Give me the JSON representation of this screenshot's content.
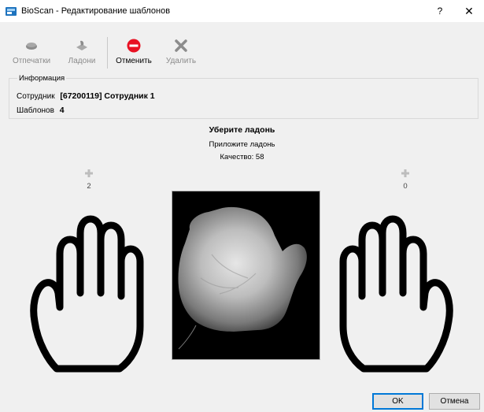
{
  "window": {
    "title": "BioScan - Редактирование шаблонов",
    "help_label": "?",
    "close_label": "✕"
  },
  "toolbar": {
    "fingerprints_label": "Отпечатки",
    "palms_label": "Ладони",
    "cancel_label": "Отменить",
    "delete_label": "Удалить"
  },
  "info": {
    "legend": "Информация",
    "employee_label": "Сотрудник",
    "employee_value": "[67200119] Сотрудник 1",
    "templates_label": "Шаблонов",
    "templates_value": "4"
  },
  "status": {
    "main": "Уберите ладонь",
    "sub": "Приложите ладонь",
    "quality": "Качество: 58"
  },
  "left_hand": {
    "count": "2"
  },
  "right_hand": {
    "count": "0"
  },
  "buttons": {
    "ok_label": "OK",
    "cancel_label": "Отмена"
  },
  "colors": {
    "window_bg": "#f0f0f0",
    "cancel_icon": "#e81123",
    "accent": "#0078d7"
  },
  "icons": {
    "app": "bioscan-app-icon",
    "fingerprints": "fingerprint-scanner-icon",
    "palms": "palm-scanner-icon",
    "cancel": "stop-icon",
    "delete": "delete-x-icon",
    "add": "plus-icon"
  }
}
